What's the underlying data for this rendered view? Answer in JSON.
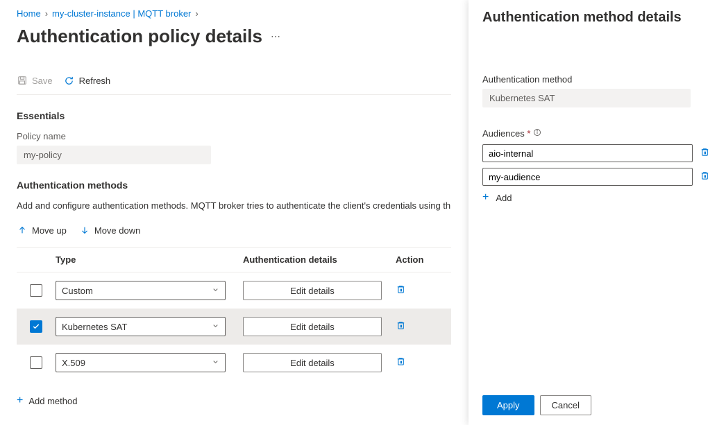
{
  "breadcrumb": {
    "home": "Home",
    "instance": "my-cluster-instance | MQTT broker"
  },
  "page": {
    "title": "Authentication policy details",
    "toolbar": {
      "save": "Save",
      "refresh": "Refresh"
    }
  },
  "essentials": {
    "heading": "Essentials",
    "policy_name_label": "Policy name",
    "policy_name_value": "my-policy"
  },
  "methods": {
    "heading": "Authentication methods",
    "description": "Add and configure authentication methods. MQTT broker tries to authenticate the client's credentials using th",
    "move_up": "Move up",
    "move_down": "Move down",
    "columns": {
      "type": "Type",
      "details": "Authentication details",
      "action": "Action"
    },
    "rows": [
      {
        "type": "Custom",
        "edit_label": "Edit details",
        "checked": false
      },
      {
        "type": "Kubernetes SAT",
        "edit_label": "Edit details",
        "checked": true
      },
      {
        "type": "X.509",
        "edit_label": "Edit details",
        "checked": false
      }
    ],
    "add_method": "Add method"
  },
  "panel": {
    "title": "Authentication method details",
    "method_label": "Authentication method",
    "method_value": "Kubernetes SAT",
    "audiences_label": "Audiences",
    "audiences": [
      "aio-internal",
      "my-audience"
    ],
    "add": "Add",
    "apply": "Apply",
    "cancel": "Cancel"
  }
}
